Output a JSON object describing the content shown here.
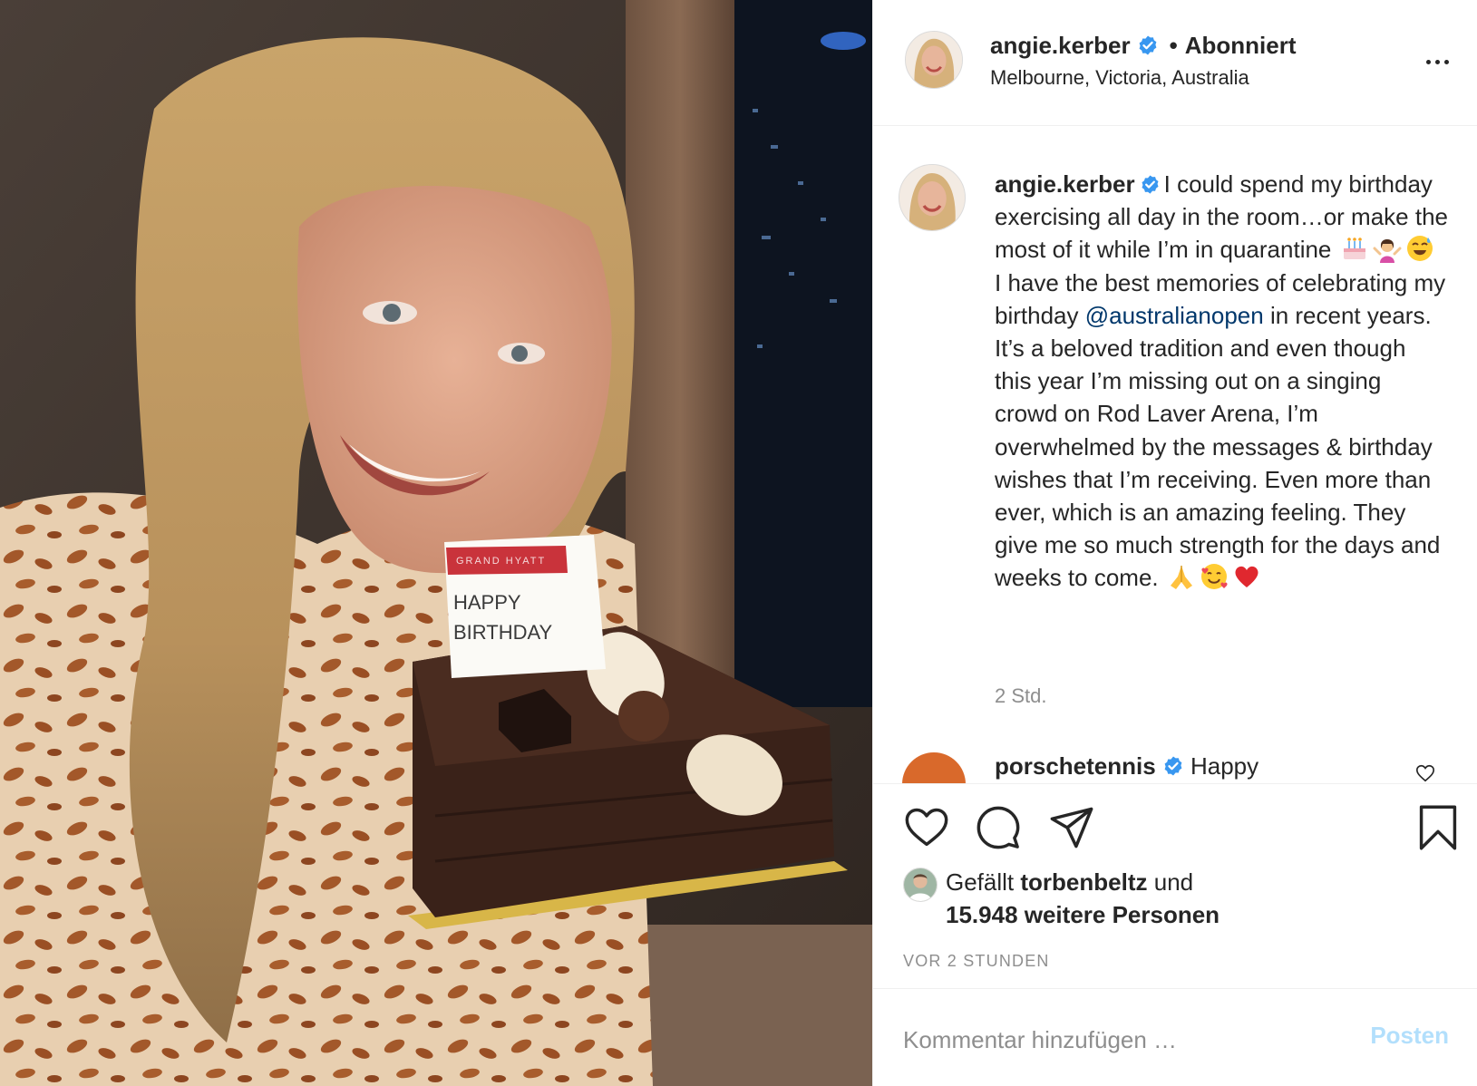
{
  "colors": {
    "link": "#00376b",
    "muted": "#8e8e8e",
    "verified": "#3897f0",
    "post_disabled": "#b2dffc",
    "heart": "#ed4956"
  },
  "photo": {
    "card_brand": "GRAND HYATT",
    "card_line1": "HAPPY",
    "card_line2": "BIRTHDAY"
  },
  "header": {
    "username": "angie.kerber",
    "separator": "•",
    "follow_state": "Abonniert",
    "location": "Melbourne, Victoria, Australia",
    "more_icon": "more-horizontal-icon"
  },
  "caption": {
    "username": "angie.kerber",
    "text_part1": "I could spend my birthday exercising all day in the room…or make the most of it while I’m in quarantine",
    "emoji_group1": [
      "birthday-cake-emoji",
      "person-shrugging-emoji",
      "sweat-smile-emoji"
    ],
    "text_part2": "I have the best memories of celebrating my birthday",
    "mention": "@australianopen",
    "text_part3": "in recent years. It’s a beloved tradition and even though this year I’m missing out on a singing crowd on Rod Laver Arena, I’m overwhelmed by the messages & birthday wishes that I’m receiving. Even more than ever, which is an amazing feeling. They give me so much strength for the days and weeks to come.",
    "emoji_group2": [
      "folded-hands-emoji",
      "smiling-face-with-hearts-emoji",
      "red-heart-emoji"
    ],
    "age": "2 Std."
  },
  "next_comment": {
    "username": "porschetennis",
    "text": "Happy"
  },
  "actions": {
    "icons": [
      "heart-icon",
      "comment-icon",
      "share-icon",
      "bookmark-icon"
    ]
  },
  "likes": {
    "prefix": "Gefällt",
    "user": "torbenbeltz",
    "connector": "und",
    "count_text": "15.948 weitere Personen"
  },
  "timestamp": "VOR 2 STUNDEN",
  "comment_box": {
    "placeholder": "Kommentar hinzufügen …",
    "post_label": "Posten"
  }
}
